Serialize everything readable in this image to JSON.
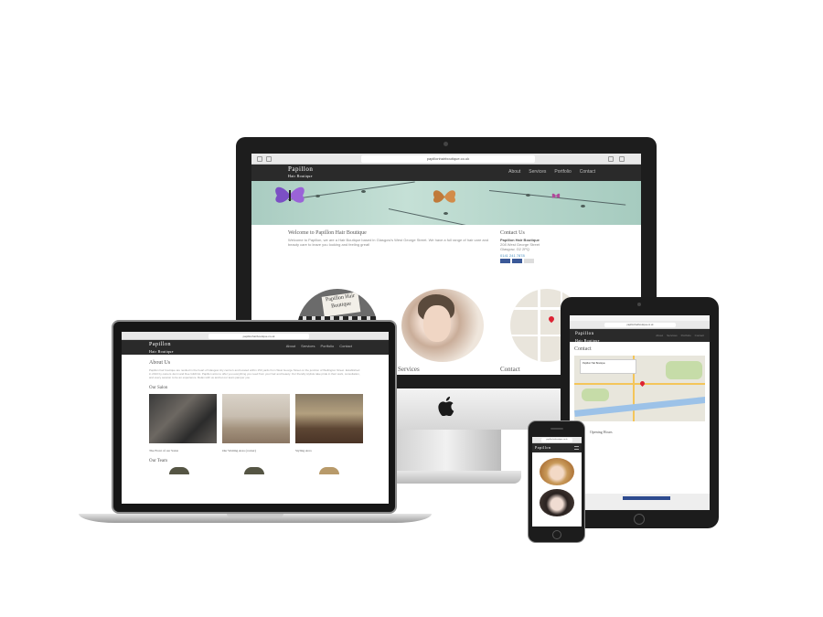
{
  "site": {
    "brand": "Papillon",
    "brand_sub": "Hair Boutique",
    "url": "papillonhairboutique.co.uk",
    "nav": [
      "About",
      "Services",
      "Portfolio",
      "Contact"
    ]
  },
  "desktop": {
    "welcome_title": "Welcome to Papillon Hair Boutique",
    "welcome_text": "Welcome to Papillon, we are a Hair Boutique based in Glasgow's West George Street. We have a full range of hair care and beauty care to leave you looking and feeling great!",
    "contact_title": "Contact Us",
    "contact_name": "Papillon Hair Boutique",
    "contact_address_1": "208 West George Street",
    "contact_address_2": "Glasgow, G2 2PQ",
    "contact_phone": "0141 241 7878",
    "salon_sign": "Papillon Hair Boutique",
    "services_label": "Services",
    "contact_label": "Contact"
  },
  "laptop": {
    "about_title": "About Us",
    "about_text": "Papillon hair boutique are nestled in the heart of Glasgow city centre's and located within 150 yards from West George Street on the junction of Wellington Street. Established in 2013 by owners Jenni and Dee Gilchrist. Papillon aims to offer you everything you need from your hair and beauty. Our friendly stylists take pride in their work, consultation, and every session to be an experience. Relax with us and let our team pamper you.",
    "salon_title": "Our Salon",
    "photos": [
      {
        "caption": "The Front of our Salon"
      },
      {
        "caption": "Our Waiting Area (corner)"
      },
      {
        "caption": "Styling Area"
      }
    ],
    "team_title": "Our Team"
  },
  "tablet": {
    "contact_title": "Contact",
    "map_place": "Papillon Hair Boutique",
    "opening_hours_title": "Opening Hours"
  },
  "colors": {
    "nav_bg": "#2a2a2a",
    "banner": "#b4d5ca",
    "link": "#4a8fbf",
    "facebook": "#3b5998"
  },
  "icons": [
    "apple-logo-icon",
    "map-pin-icon",
    "menu-icon",
    "facebook-like-icon"
  ]
}
